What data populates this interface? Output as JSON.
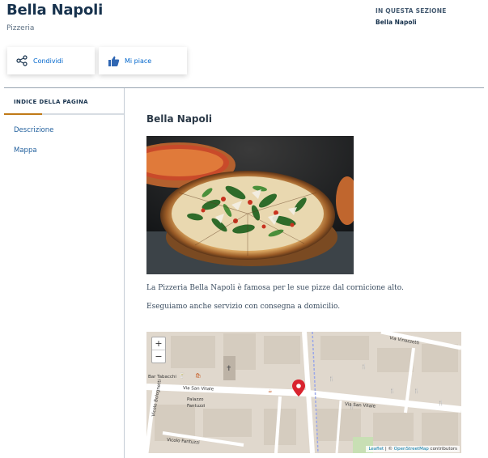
{
  "header": {
    "title": "Bella Napoli",
    "subtitle": "Pizzeria",
    "section_label": "IN QUESTA SEZIONE",
    "section_link": "Bella Napoli"
  },
  "actions": {
    "share_label": "Condividi",
    "like_label": "Mi piace",
    "share_icon": "share-icon",
    "like_icon": "thumbs-up-icon"
  },
  "toc": {
    "title": "INDICE DELLA PAGINA",
    "items": [
      {
        "label": "Descrizione"
      },
      {
        "label": "Mappa"
      }
    ]
  },
  "content": {
    "heading": "Bella Napoli",
    "paragraphs": [
      "La Pizzeria Bella Napoli è famosa per le sue pizze dal cornicione alto.",
      "Eseguiamo anche servizio con consegna a domicilio."
    ]
  },
  "map": {
    "zoom_in": "+",
    "zoom_out": "−",
    "attribution_leaflet": "Leaflet",
    "attribution_sep": " | © ",
    "attribution_osm": "OpenStreetMap",
    "attribution_tail": " contributors",
    "streets": [
      "Via San Vitale",
      "Via Vinazzetti",
      "Bar Tabacchi",
      "Palazzo Fantuzzi",
      "Vicolo Fantuzzi",
      "Vicolo Bolognetti"
    ]
  },
  "colors": {
    "title": "#17324d",
    "link": "#0066cc",
    "accent": "#c07a17",
    "marker": "#d9232e"
  }
}
